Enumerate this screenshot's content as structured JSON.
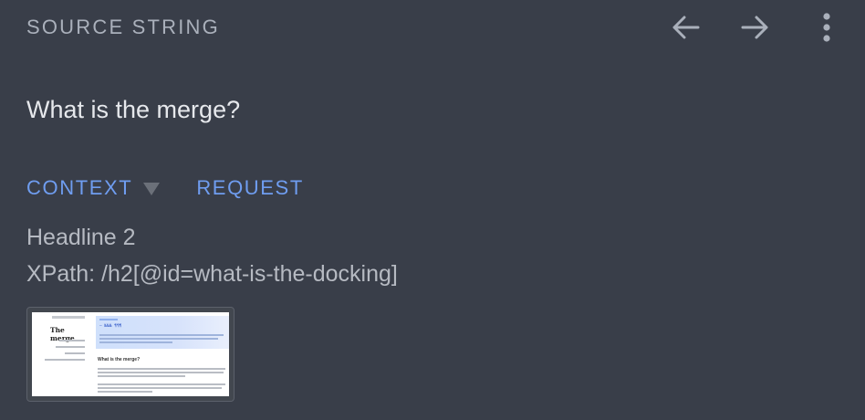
{
  "header": {
    "section_label": "SOURCE STRING",
    "prev_icon": "arrow-left-icon",
    "next_icon": "arrow-right-icon",
    "more_icon": "more-vertical-icon"
  },
  "source": {
    "text": "What is the merge?"
  },
  "tabs": [
    {
      "label": "CONTEXT",
      "has_dropdown": true
    },
    {
      "label": "REQUEST",
      "has_dropdown": false
    }
  ],
  "context": {
    "element_type": "Headline 2",
    "xpath": "XPath: /h2[@id=what-is-the-docking]"
  },
  "screenshot_thumbnail": {
    "sidebar_title": "The merge",
    "banner_title": "— №№№ ¶¶¶",
    "section_heading": "What is the merge?"
  },
  "colors": {
    "background": "#393e49",
    "accent": "#6f9df0",
    "primary_text": "#e6e8ec",
    "secondary_text": "#b6bac2",
    "label_text": "#aab0bb"
  }
}
